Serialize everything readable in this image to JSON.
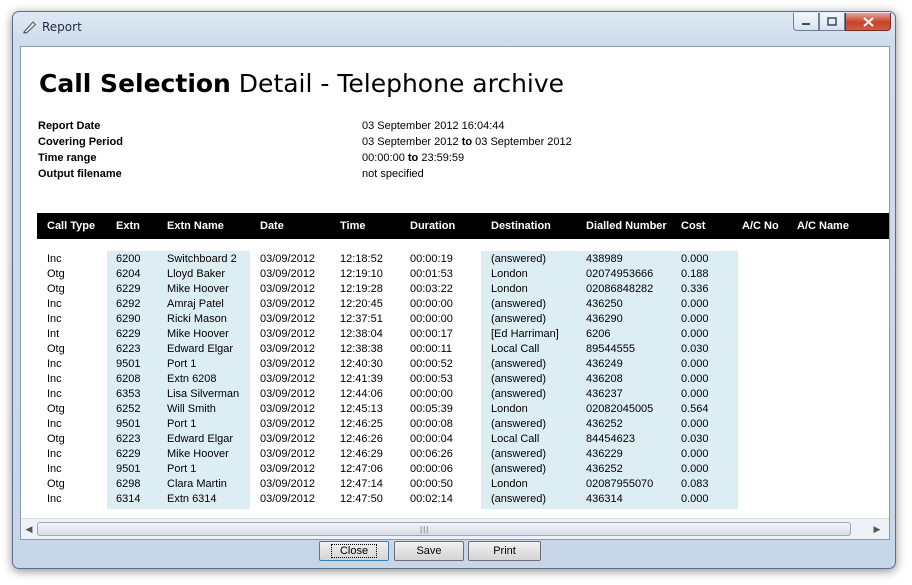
{
  "window": {
    "title": "Report"
  },
  "report": {
    "heading_bold": "Call Selection",
    "heading_rest": " Detail - Telephone archive",
    "meta": [
      {
        "label": "Report Date",
        "value": "03 September 2012 16:04:44"
      },
      {
        "label": "Covering Period",
        "value_from": "03 September 2012",
        "value_sep": "to",
        "value_to": "03 September 2012"
      },
      {
        "label": "Time range",
        "value_from": "00:00:00",
        "value_sep": "to",
        "value_to": "23:59:59"
      },
      {
        "label": "Output filename",
        "value": "not specified"
      }
    ],
    "columns": [
      "Call Type",
      "Extn",
      "Extn Name",
      "Date",
      "Time",
      "Duration",
      "Destination",
      "Dialled Number",
      "Cost",
      "A/C No",
      "A/C Name"
    ],
    "rows": [
      [
        "Inc",
        "6200",
        "Switchboard 2",
        "03/09/2012",
        "12:18:52",
        "00:00:19",
        "(answered)",
        "438989",
        "0.000"
      ],
      [
        "Otg",
        "6204",
        "Lloyd Baker",
        "03/09/2012",
        "12:19:10",
        "00:01:53",
        "London",
        "02074953666",
        "0.188"
      ],
      [
        "Otg",
        "6229",
        "Mike Hoover",
        "03/09/2012",
        "12:19:28",
        "00:03:22",
        "London",
        "02086848282",
        "0.336"
      ],
      [
        "Inc",
        "6292",
        "Amraj Patel",
        "03/09/2012",
        "12:20:45",
        "00:00:00",
        "(answered)",
        "436250",
        "0.000"
      ],
      [
        "Inc",
        "6290",
        "Ricki Mason",
        "03/09/2012",
        "12:37:51",
        "00:00:00",
        "(answered)",
        "436290",
        "0.000"
      ],
      [
        "Int",
        "6229",
        "Mike Hoover",
        "03/09/2012",
        "12:38:04",
        "00:00:17",
        "[Ed Harriman]",
        "6206",
        "0.000"
      ],
      [
        "Otg",
        "6223",
        "Edward Elgar",
        "03/09/2012",
        "12:38:38",
        "00:00:11",
        "Local Call",
        "89544555",
        "0.030"
      ],
      [
        "Inc",
        "9501",
        "Port 1",
        "03/09/2012",
        "12:40:30",
        "00:00:52",
        "(answered)",
        "436249",
        "0.000"
      ],
      [
        "Inc",
        "6208",
        "Extn 6208",
        "03/09/2012",
        "12:41:39",
        "00:00:53",
        "(answered)",
        "436208",
        "0.000"
      ],
      [
        "Inc",
        "6353",
        "Lisa Silverman",
        "03/09/2012",
        "12:44:06",
        "00:00:00",
        "(answered)",
        "436237",
        "0.000"
      ],
      [
        "Otg",
        "6252",
        "Will Smith",
        "03/09/2012",
        "12:45:13",
        "00:05:39",
        "London",
        "02082045005",
        "0.564"
      ],
      [
        "Inc",
        "9501",
        "Port 1",
        "03/09/2012",
        "12:46:25",
        "00:00:08",
        "(answered)",
        "436252",
        "0.000"
      ],
      [
        "Otg",
        "6223",
        "Edward Elgar",
        "03/09/2012",
        "12:46:26",
        "00:00:04",
        "Local Call",
        "84454623",
        "0.030"
      ],
      [
        "Inc",
        "6229",
        "Mike Hoover",
        "03/09/2012",
        "12:46:29",
        "00:06:26",
        "(answered)",
        "436229",
        "0.000"
      ],
      [
        "Inc",
        "9501",
        "Port 1",
        "03/09/2012",
        "12:47:06",
        "00:00:06",
        "(answered)",
        "436252",
        "0.000"
      ],
      [
        "Otg",
        "6298",
        "Clara Martin",
        "03/09/2012",
        "12:47:14",
        "00:00:50",
        "London",
        "02087955070",
        "0.083"
      ],
      [
        "Inc",
        "6314",
        "Extn 6314",
        "03/09/2012",
        "12:47:50",
        "00:02:14",
        "(answered)",
        "436314",
        "0.000"
      ]
    ]
  },
  "buttons": {
    "close": "Close",
    "save": "Save",
    "print": "Print"
  },
  "colors": {
    "header_bg": "#000000",
    "column_shade": "#ddedf4"
  }
}
